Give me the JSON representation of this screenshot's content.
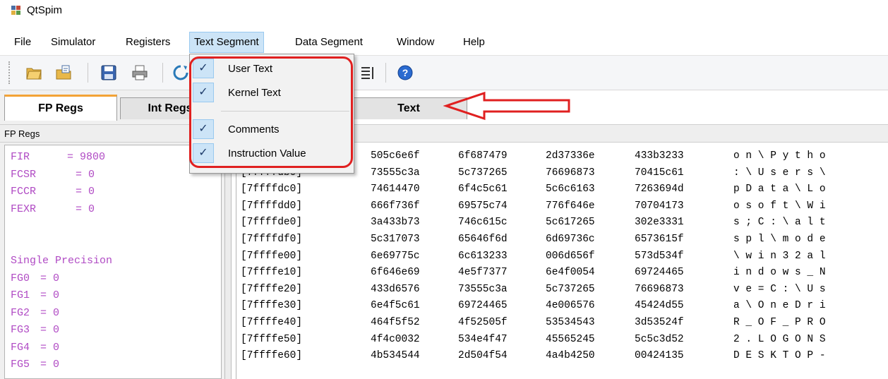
{
  "window": {
    "title": "QtSpim"
  },
  "menu": {
    "items": [
      "File",
      "Simulator",
      "Registers",
      "Text Segment",
      "Data Segment",
      "Window",
      "Help"
    ]
  },
  "tabs": {
    "fp": "FP Regs",
    "int": "Int Regs",
    "text": "Text"
  },
  "left_pane": {
    "label": "FP Regs"
  },
  "fp_regs": [
    {
      "name": "FIR",
      "value": "= 9800"
    },
    {
      "name": "FCSR",
      "value": "= 0"
    },
    {
      "name": "FCCR",
      "value": "= 0"
    },
    {
      "name": "FEXR",
      "value": "= 0"
    },
    {
      "name": "",
      "value": ""
    },
    {
      "name": "",
      "value": ""
    },
    {
      "name": "Single Precision",
      "value": ""
    },
    {
      "name": "FG0",
      "value": "= 0"
    },
    {
      "name": "FG1",
      "value": "= 0"
    },
    {
      "name": "FG2",
      "value": "= 0"
    },
    {
      "name": "FG3",
      "value": "= 0"
    },
    {
      "name": "FG4",
      "value": "= 0"
    },
    {
      "name": "FG5",
      "value": "= 0"
    }
  ],
  "dropdown": {
    "items": [
      "User Text",
      "Kernel Text",
      "Comments",
      "Instruction Value"
    ]
  },
  "data_rows": [
    {
      "addr": "",
      "w0": "505c6e6f",
      "w1": "6f687479",
      "w2": "2d37336e",
      "w3": "433b3233",
      "ascii": "o n \\ P y t h o"
    },
    {
      "addr": "[7ffffdb0]",
      "w0": "73555c3a",
      "w1": "5c737265",
      "w2": "76696873",
      "w3": "70415c61",
      "ascii": ": \\ U s e r s \\"
    },
    {
      "addr": "[7ffffdc0]",
      "w0": "74614470",
      "w1": "6f4c5c61",
      "w2": "5c6c6163",
      "w3": "7263694d",
      "ascii": "p D a t a \\ L o"
    },
    {
      "addr": "[7ffffdd0]",
      "w0": "666f736f",
      "w1": "69575c74",
      "w2": "776f646e",
      "w3": "70704173",
      "ascii": "o s o f t \\ W i"
    },
    {
      "addr": "[7ffffde0]",
      "w0": "3a433b73",
      "w1": "746c615c",
      "w2": "5c617265",
      "w3": "302e3331",
      "ascii": "s ; C : \\ a l t"
    },
    {
      "addr": "[7ffffdf0]",
      "w0": "5c317073",
      "w1": "65646f6d",
      "w2": "6d69736c",
      "w3": "6573615f",
      "ascii": "s p l \\ m o d e"
    },
    {
      "addr": "[7ffffe00]",
      "w0": "6e69775c",
      "w1": "6c613233",
      "w2": "006d656f",
      "w3": "573d534f",
      "ascii": "\\ w i n 3 2 a l"
    },
    {
      "addr": "[7ffffe10]",
      "w0": "6f646e69",
      "w1": "4e5f7377",
      "w2": "6e4f0054",
      "w3": "69724465",
      "ascii": "i n d o w s _ N"
    },
    {
      "addr": "[7ffffe20]",
      "w0": "433d6576",
      "w1": "73555c3a",
      "w2": "5c737265",
      "w3": "76696873",
      "ascii": "v e = C : \\ U s"
    },
    {
      "addr": "[7ffffe30]",
      "w0": "6e4f5c61",
      "w1": "69724465",
      "w2": "4e006576",
      "w3": "45424d55",
      "ascii": "a \\ O n e D r i"
    },
    {
      "addr": "[7ffffe40]",
      "w0": "464f5f52",
      "w1": "4f52505f",
      "w2": "53534543",
      "w3": "3d53524f",
      "ascii": "R _ O F _ P R O"
    },
    {
      "addr": "[7ffffe50]",
      "w0": "4f4c0032",
      "w1": "534e4f47",
      "w2": "45565245",
      "w3": "5c5c3d52",
      "ascii": "2 . L O G O N S"
    },
    {
      "addr": "[7ffffe60]",
      "w0": "4b534544",
      "w1": "2d504f54",
      "w2": "4a4b4250",
      "w3": "00424135",
      "ascii": "D E S K T O P -"
    }
  ],
  "colors": {
    "reg_text": "#b04ac4",
    "accent_tab": "#f3a336",
    "annotation": "#e02020",
    "menu_highlight": "#cce4f7"
  }
}
